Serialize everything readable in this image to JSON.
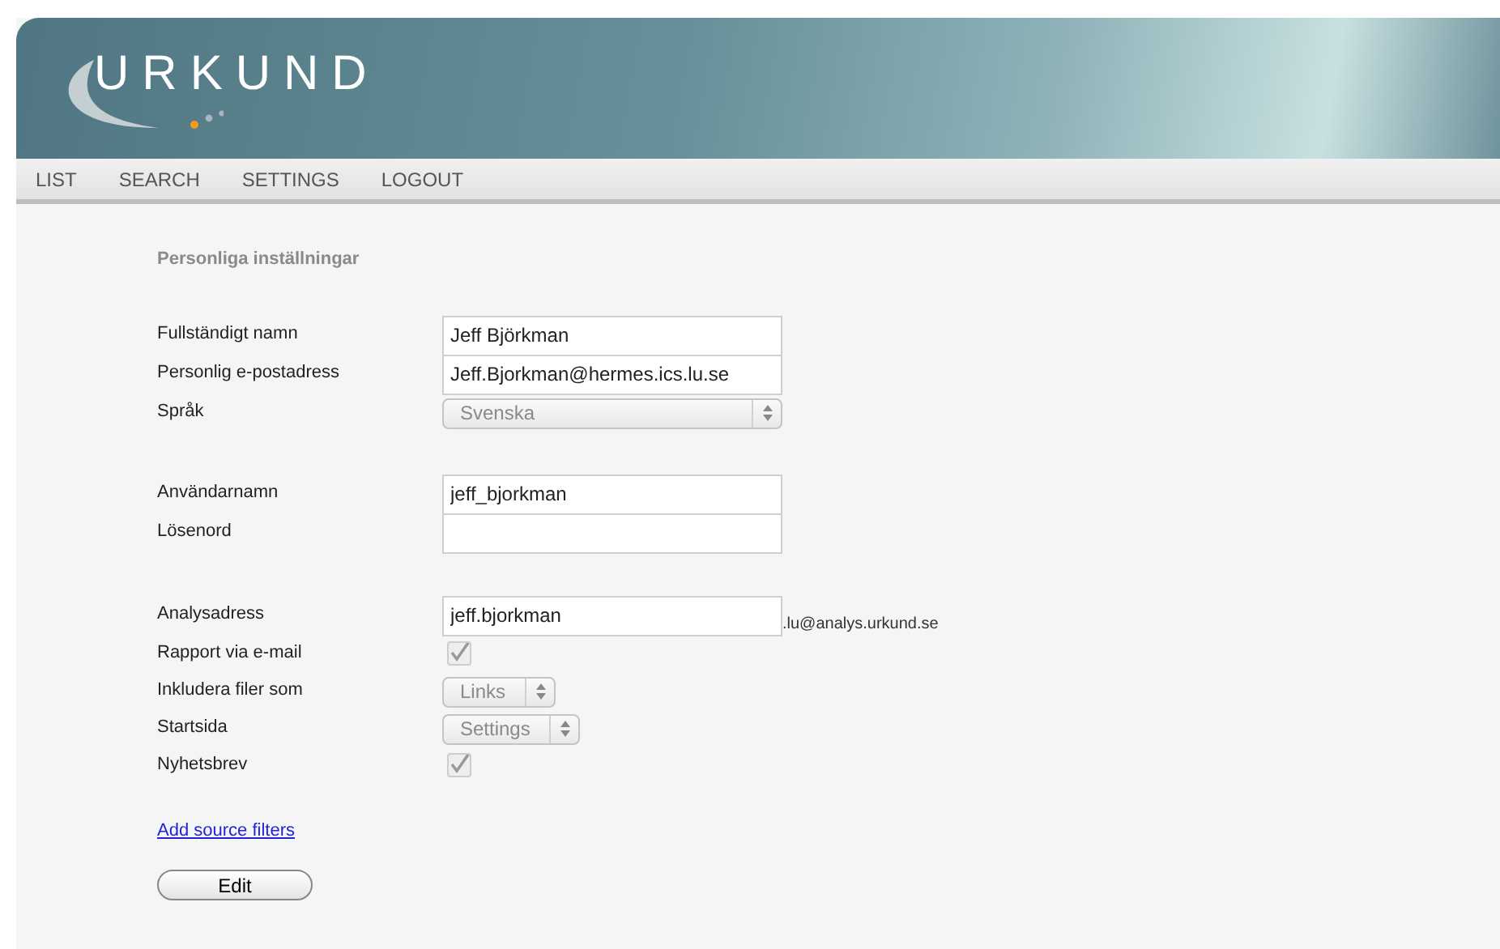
{
  "header": {
    "logo": "URKUND"
  },
  "nav": [
    {
      "label": "LIST"
    },
    {
      "label": "SEARCH"
    },
    {
      "label": "SETTINGS"
    },
    {
      "label": "LOGOUT"
    }
  ],
  "section_title": "Personliga inställningar",
  "groups": [
    [
      {
        "kind": "text",
        "label": "Fullständigt namn",
        "value": "Jeff Björkman"
      },
      {
        "kind": "text",
        "label": "Personlig e-postadress",
        "value": "Jeff.Bjorkman@hermes.ics.lu.se"
      },
      {
        "kind": "select",
        "label": "Språk",
        "value": "Svenska"
      }
    ],
    [
      {
        "kind": "text",
        "label": "Användarnamn",
        "value": "jeff_bjorkman"
      },
      {
        "kind": "text",
        "label": "Lösenord"
      }
    ],
    [
      {
        "kind": "text",
        "label": "Analysadress",
        "value": "jeff.bjorkman",
        "suffix": ".lu@analys.urkund.se"
      },
      {
        "kind": "checkbox",
        "label": "Rapport via e-mail",
        "checked": true,
        "disabled": true
      },
      {
        "kind": "select",
        "label": "Inkludera filer som",
        "value": "Links"
      },
      {
        "kind": "select",
        "label": "Startsida",
        "value": "Settings"
      },
      {
        "kind": "checkbox",
        "label": "Nyhetsbrev",
        "checked": true,
        "disabled": true
      }
    ]
  ],
  "link": "Add source filters",
  "button": "Edit"
}
